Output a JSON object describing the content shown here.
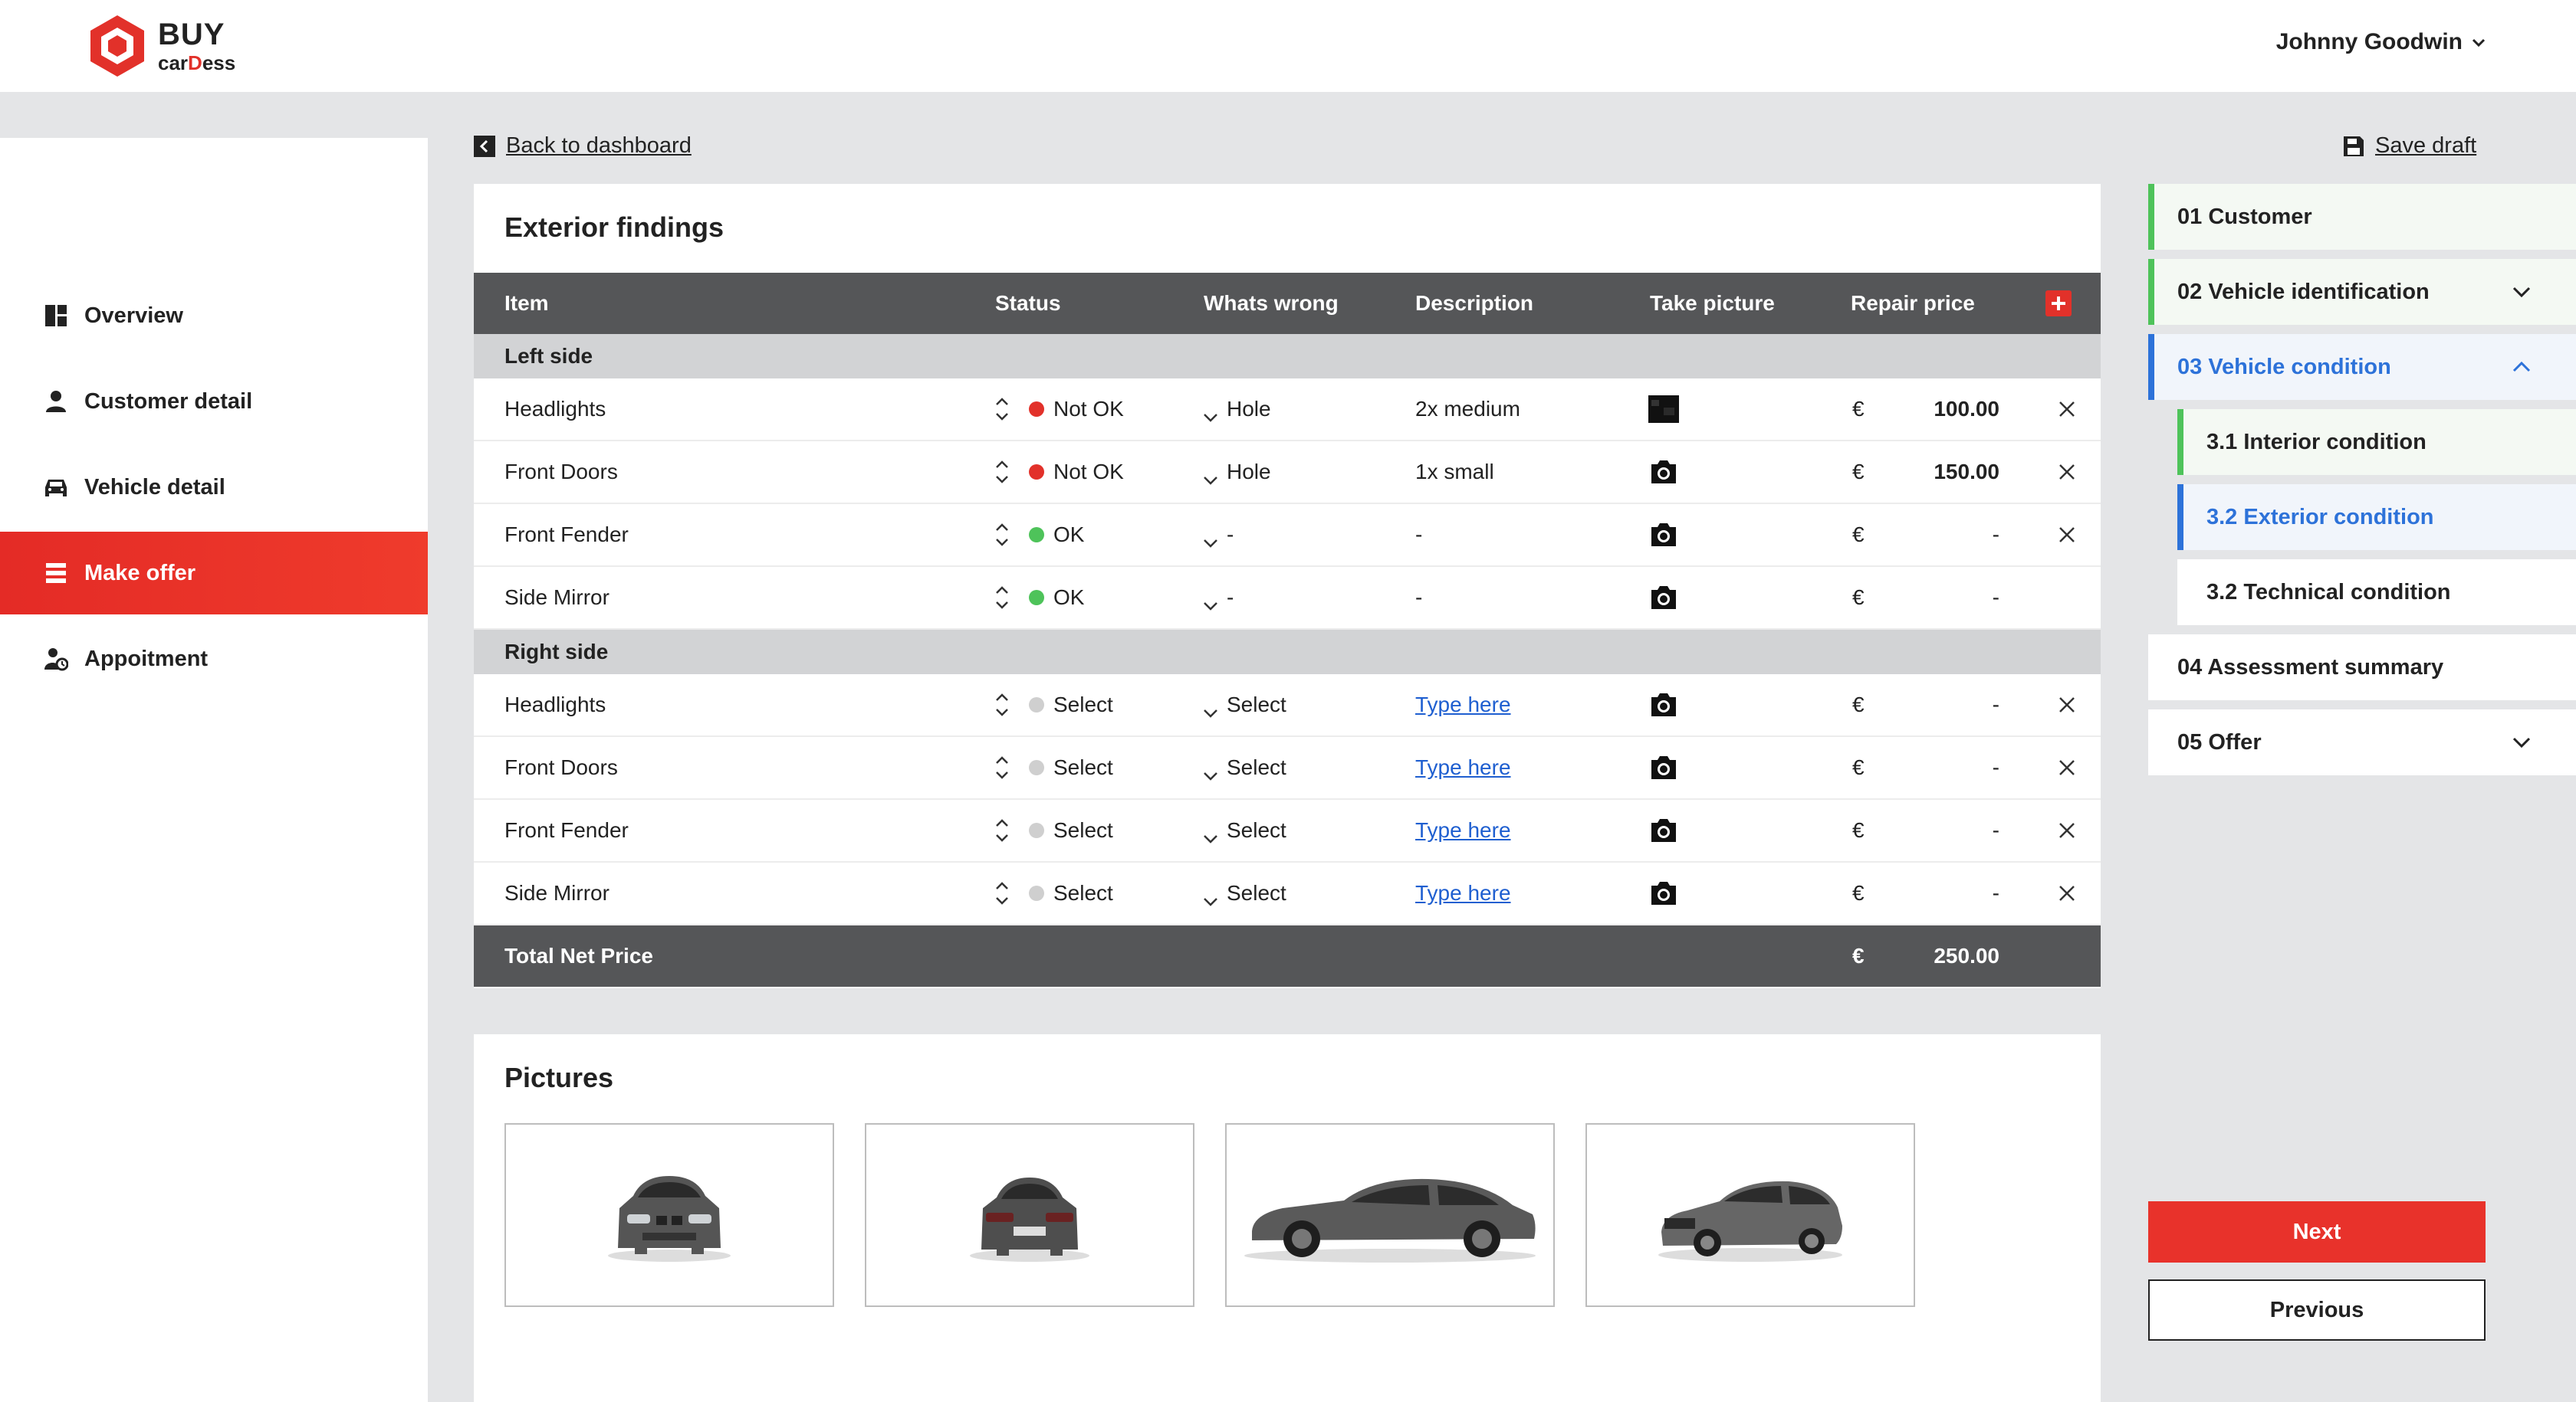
{
  "brand": {
    "name": "BUY",
    "sub_prefix": "car",
    "sub_accent": "D",
    "sub_suffix": "ess",
    "accent": "#e2312a"
  },
  "user": {
    "name": "Johnny Goodwin"
  },
  "sidebar": {
    "items": [
      {
        "label": "Overview",
        "icon": "overview-icon"
      },
      {
        "label": "Customer detail",
        "icon": "person-icon"
      },
      {
        "label": "Vehicle detail",
        "icon": "car-icon"
      },
      {
        "label": "Make offer",
        "icon": "list-icon",
        "active": true
      },
      {
        "label": "Appoitment",
        "icon": "calendar-person-icon"
      }
    ]
  },
  "links": {
    "back": "Back to dashboard",
    "save": "Save draft"
  },
  "exterior": {
    "title": "Exterior findings",
    "columns": [
      "Item",
      "Status",
      "Whats wrong",
      "Description",
      "Take picture",
      "Repair price"
    ],
    "sections": [
      {
        "name": "Left side",
        "rows": [
          {
            "item": "Headlights",
            "status": "Not OK",
            "status_color": "#e2312a",
            "wrong": "Hole",
            "desc": "2x medium",
            "currency": "€",
            "price": "100.00"
          },
          {
            "item": "Front Doors",
            "status": "Not OK",
            "status_color": "#e2312a",
            "wrong": "Hole",
            "desc": "1x small",
            "currency": "€",
            "price": "150.00"
          },
          {
            "item": "Front Fender",
            "status": "OK",
            "status_color": "#4ec35a",
            "wrong": "-",
            "desc": "-",
            "currency": "€",
            "price": "-"
          },
          {
            "item": "Side Mirror",
            "status": "OK",
            "status_color": "#4ec35a",
            "wrong": "-",
            "desc": "-",
            "currency": "€",
            "price": "-"
          }
        ]
      },
      {
        "name": "Right side",
        "rows": [
          {
            "item": "Headlights",
            "status": "Select",
            "status_color": "#cfcfcf",
            "wrong": "Select",
            "desc": "Type here",
            "currency": "€",
            "price": "-"
          },
          {
            "item": "Front Doors",
            "status": "Select",
            "status_color": "#cfcfcf",
            "wrong": "Select",
            "desc": "Type here",
            "currency": "€",
            "price": "-"
          },
          {
            "item": "Front Fender",
            "status": "Select",
            "status_color": "#cfcfcf",
            "wrong": "Select",
            "desc": "Type here",
            "currency": "€",
            "price": "-"
          },
          {
            "item": "Side Mirror",
            "status": "Select",
            "status_color": "#cfcfcf",
            "wrong": "Select",
            "desc": "Type here",
            "currency": "€",
            "price": "-"
          }
        ]
      }
    ],
    "total": {
      "label": "Total Net Price",
      "currency": "€",
      "value": "250.00"
    }
  },
  "pictures": {
    "title": "Pictures"
  },
  "steps": [
    {
      "label": "01 Customer"
    },
    {
      "label": "02 Vehicle identification"
    },
    {
      "label": "03 Vehicle condition"
    },
    {
      "label": "3.1 Interior condition"
    },
    {
      "label": "3.2 Exterior condition"
    },
    {
      "label": "3.2 Technical condition"
    },
    {
      "label": "04 Assessment summary"
    },
    {
      "label": "05 Offer"
    }
  ],
  "buttons": {
    "next": "Next",
    "previous": "Previous"
  }
}
